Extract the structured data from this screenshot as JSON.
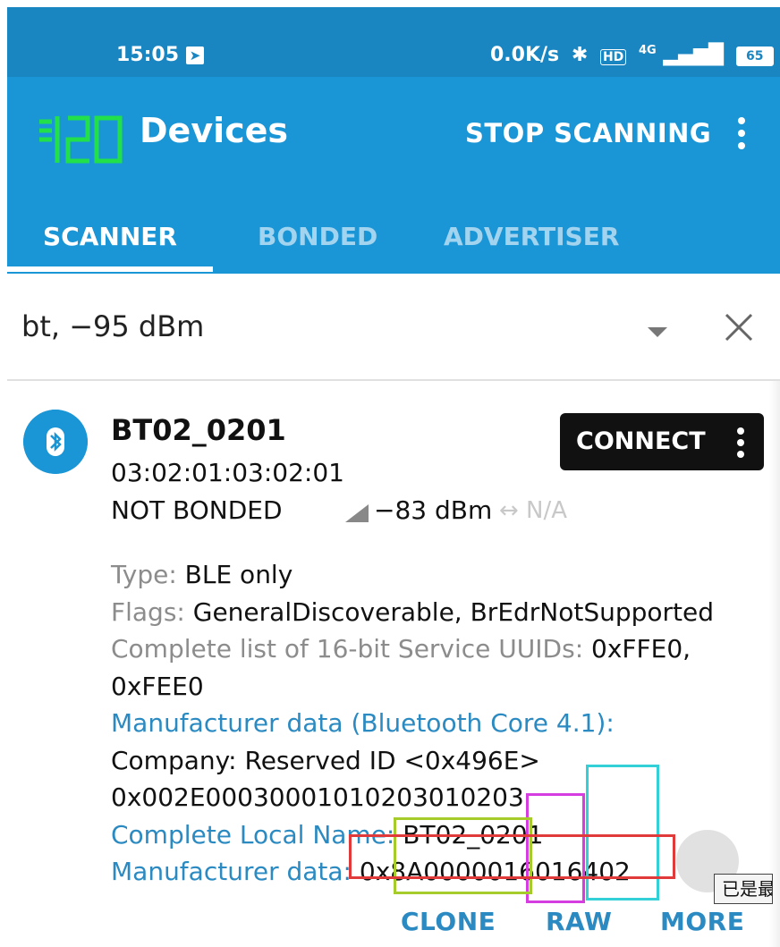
{
  "status_bar": {
    "time": "15:05",
    "net_speed": "0.0K/s",
    "network": "4G",
    "battery": "65"
  },
  "app_bar": {
    "title": "Devices",
    "stop_scanning": "STOP SCANNING",
    "tabs": [
      {
        "label": "SCANNER",
        "active": true
      },
      {
        "label": "BONDED",
        "active": false
      },
      {
        "label": "ADVERTISER",
        "active": false
      }
    ]
  },
  "filter": {
    "text": "bt, −95 dBm"
  },
  "device": {
    "name": "BT02_0201",
    "mac": "03:02:01:03:02:01",
    "bond_state": "NOT BONDED",
    "rssi": "−83 dBm",
    "interval": "↔ N/A",
    "connect_label": "CONNECT",
    "details": {
      "type_label": "Type:",
      "type_value": "BLE only",
      "flags_label": "Flags:",
      "flags_value": "GeneralDiscoverable, BrEdrNotSupported",
      "uuids_label": "Complete list of 16-bit Service UUIDs:",
      "uuids_value": "0xFFE0, 0xFEE0",
      "mfr_label": "Manufacturer data (Bluetooth Core 4.1):",
      "company": "Company: Reserved ID <0x496E>",
      "mfr_hex": "0x002E00030001010203010203",
      "local_name_label": "Complete Local Name:",
      "local_name_value": "BT02_0201",
      "mfr2_label": "Manufacturer data:",
      "mfr2_value": "0x8A0000016016402"
    },
    "actions": [
      "CLONE",
      "RAW",
      "MORE"
    ]
  },
  "toast": "已是最",
  "colors": {
    "app_bar": "#1a95d6",
    "status_bar": "#1a86c1",
    "accent_text": "#2a8ac1",
    "logo": "#22e04a"
  }
}
